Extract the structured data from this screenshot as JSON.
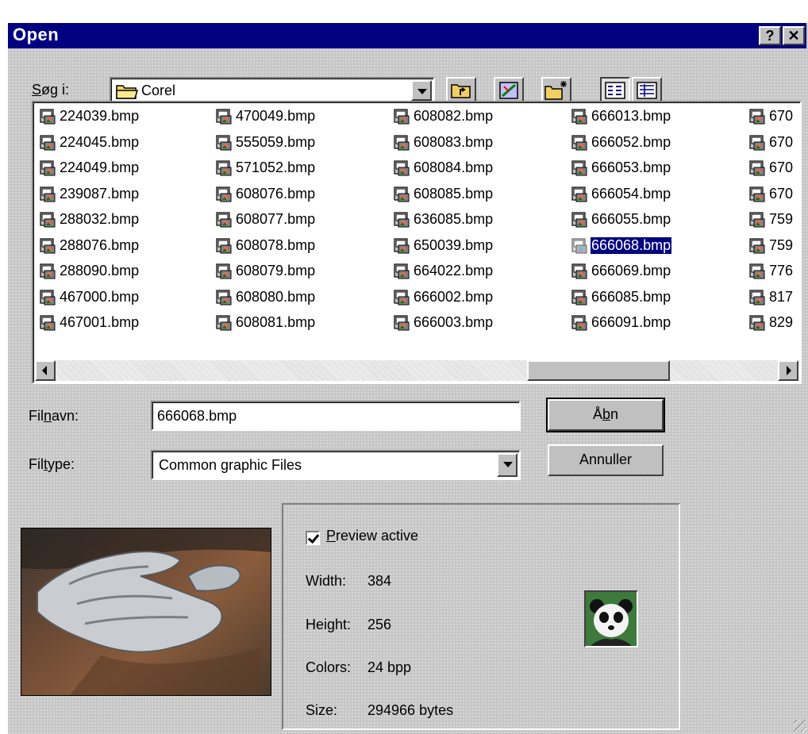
{
  "window": {
    "title": "Open",
    "help_label": "?",
    "close_label": "✕"
  },
  "lookin": {
    "label_prefix": "",
    "label_underlined": "S",
    "label_rest": "øg i:",
    "value": "Corel"
  },
  "files": [
    "224039.bmp",
    "224045.bmp",
    "224049.bmp",
    "239087.bmp",
    "288032.bmp",
    "288076.bmp",
    "288090.bmp",
    "467000.bmp",
    "467001.bmp",
    "470049.bmp",
    "555059.bmp",
    "571052.bmp",
    "608076.bmp",
    "608077.bmp",
    "608078.bmp",
    "608079.bmp",
    "608080.bmp",
    "608081.bmp",
    "608082.bmp",
    "608083.bmp",
    "608084.bmp",
    "608085.bmp",
    "636085.bmp",
    "650039.bmp",
    "664022.bmp",
    "666002.bmp",
    "666003.bmp",
    "666013.bmp",
    "666052.bmp",
    "666053.bmp",
    "666054.bmp",
    "666055.bmp",
    "666068.bmp",
    "666069.bmp",
    "666085.bmp",
    "666091.bmp",
    "670",
    "670",
    "670",
    "670",
    "759",
    "759",
    "776",
    "817",
    "829"
  ],
  "selected_file": "666068.bmp",
  "filename": {
    "label_pre": "Fil",
    "label_u": "n",
    "label_post": "avn:",
    "value": "666068.bmp"
  },
  "filetype": {
    "label_pre": "Fil",
    "label_u": "t",
    "label_post": "ype:",
    "value": "Common graphic Files"
  },
  "buttons": {
    "open_pre": "Å",
    "open_u": "b",
    "open_post": "n",
    "cancel": "Annuller"
  },
  "preview": {
    "active_u": "P",
    "active_rest": "review active",
    "active_checked": true,
    "width_label": "Width:",
    "width_value": "384",
    "height_label": "Height:",
    "height_value": "256",
    "colors_label": "Colors:",
    "colors_value": "24 bpp",
    "size_label": "Size:",
    "size_value": "294966 bytes"
  },
  "icons": {
    "folder": "folder-icon",
    "up": "up-one-level-icon",
    "desktop": "desktop-icon",
    "newfolder": "new-folder-icon",
    "list": "list-view-icon",
    "details": "details-view-icon",
    "file": "bitmap-file-icon"
  },
  "colors": {
    "titlebar": "#000080",
    "face": "#c0c0c0",
    "selection": "#000080"
  }
}
